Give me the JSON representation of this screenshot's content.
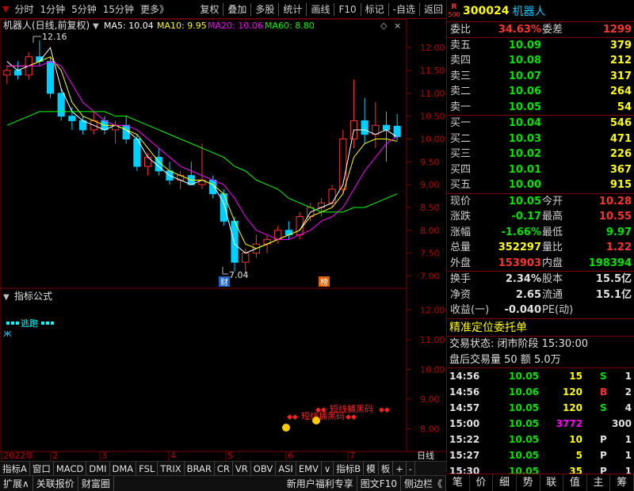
{
  "toolbar": {
    "left": [
      "分时",
      "1分钟",
      "5分钟",
      "15分钟",
      "更多》"
    ],
    "right": [
      "复权",
      "叠加",
      "多股",
      "统计",
      "画线",
      "F10",
      "标记",
      "-自选",
      "返回"
    ]
  },
  "chart": {
    "title": "机器人(日线,前复权)",
    "ma": [
      {
        "label": "MA5: 10.04",
        "color": "#ffffff"
      },
      {
        "label": "MA10: 9.95",
        "color": "#ffff00"
      },
      {
        "label": "MA20: 10.06",
        "color": "#ff00ff"
      },
      {
        "label": "MA60: 8.80",
        "color": "#00ff00"
      }
    ],
    "high_label": "12.16",
    "low_label": "7.04",
    "cai_mark": "财",
    "bang_mark": "榜",
    "indicator_title": "指标公式",
    "escape_label": "逃跑",
    "signal1": "短线捕黑码",
    "signal2": "短线捕黑码",
    "date_labels": [
      "2022年",
      "2",
      "3",
      "4",
      "5",
      "6",
      "7"
    ],
    "rhs_bottom": "日线"
  },
  "chart_data": [
    {
      "type": "line",
      "title": "",
      "ylim": [
        6.8,
        12.35
      ],
      "y_ticks": [
        7.0,
        7.5,
        8.0,
        8.5,
        9.0,
        9.5,
        10.0,
        10.5,
        11.0,
        11.5,
        12.0
      ],
      "x_ticks": [
        "2022年",
        "2",
        "3",
        "4",
        "5",
        "6",
        "7"
      ],
      "series": [
        {
          "name": "MA5",
          "values": [
            11.7,
            11.5,
            11.6,
            11.7,
            12.0,
            11.1,
            10.6,
            10.4,
            10.3,
            10.2,
            10.3,
            10.2,
            10.0,
            9.6,
            9.4,
            9.2,
            9.1,
            9.0,
            9.1,
            9.0,
            8.6,
            7.7,
            7.5,
            7.6,
            7.7,
            7.8,
            7.9,
            8.0,
            8.4,
            8.5,
            8.6,
            9.0,
            10.2,
            10.2,
            10.1,
            10.2,
            10.04
          ]
        },
        {
          "name": "MA10",
          "values": [
            11.6,
            11.6,
            11.6,
            11.7,
            11.8,
            11.5,
            10.8,
            10.5,
            10.4,
            10.3,
            10.3,
            10.2,
            10.1,
            9.8,
            9.5,
            9.3,
            9.2,
            9.1,
            9.1,
            9.0,
            8.8,
            8.2,
            7.7,
            7.6,
            7.7,
            7.8,
            7.9,
            8.0,
            8.3,
            8.4,
            8.5,
            8.8,
            9.6,
            9.9,
            10.0,
            10.0,
            9.95
          ]
        },
        {
          "name": "MA20",
          "values": [
            11.6,
            11.6,
            11.6,
            11.6,
            11.7,
            11.6,
            11.2,
            10.8,
            10.6,
            10.4,
            10.3,
            10.3,
            10.2,
            10.0,
            9.8,
            9.6,
            9.4,
            9.3,
            9.2,
            9.1,
            9.0,
            8.7,
            8.3,
            8.0,
            7.9,
            7.8,
            7.8,
            7.9,
            8.0,
            8.2,
            8.3,
            8.5,
            8.9,
            9.3,
            9.6,
            9.9,
            10.06
          ]
        },
        {
          "name": "MA60",
          "values": [
            10.3,
            10.4,
            10.5,
            10.6,
            10.6,
            10.6,
            10.6,
            10.6,
            10.6,
            10.6,
            10.5,
            10.5,
            10.4,
            10.3,
            10.2,
            10.1,
            10.0,
            9.9,
            9.8,
            9.7,
            9.6,
            9.4,
            9.3,
            9.1,
            9.0,
            8.9,
            8.7,
            8.6,
            8.5,
            8.4,
            8.4,
            8.4,
            8.5,
            8.5,
            8.6,
            8.7,
            8.8
          ]
        }
      ],
      "candles": [
        [
          11.4,
          11.6,
          11.2,
          11.5
        ],
        [
          11.5,
          11.7,
          11.3,
          11.4
        ],
        [
          11.4,
          11.9,
          11.3,
          11.8
        ],
        [
          11.8,
          12.16,
          11.6,
          11.7
        ],
        [
          11.7,
          11.8,
          10.9,
          11.0
        ],
        [
          11.0,
          11.1,
          10.4,
          10.5
        ],
        [
          10.5,
          10.7,
          10.2,
          10.4
        ],
        [
          10.4,
          10.5,
          10.1,
          10.2
        ],
        [
          10.2,
          10.6,
          10.1,
          10.4
        ],
        [
          10.4,
          10.5,
          10.1,
          10.2
        ],
        [
          10.2,
          10.4,
          9.9,
          10.3
        ],
        [
          10.3,
          10.5,
          9.9,
          10.0
        ],
        [
          10.0,
          10.1,
          9.3,
          9.4
        ],
        [
          9.4,
          9.7,
          9.2,
          9.6
        ],
        [
          9.6,
          9.8,
          9.2,
          9.3
        ],
        [
          9.3,
          9.5,
          9.0,
          9.1
        ],
        [
          9.1,
          9.3,
          8.9,
          9.2
        ],
        [
          9.2,
          9.5,
          9.0,
          9.0
        ],
        [
          9.0,
          9.9,
          8.9,
          9.1
        ],
        [
          9.1,
          9.2,
          8.7,
          8.8
        ],
        [
          8.8,
          8.9,
          8.1,
          8.2
        ],
        [
          8.2,
          8.3,
          7.1,
          7.3
        ],
        [
          7.3,
          7.6,
          7.04,
          7.5
        ],
        [
          7.5,
          7.9,
          7.4,
          7.7
        ],
        [
          7.7,
          7.9,
          7.5,
          7.8
        ],
        [
          7.8,
          8.1,
          7.7,
          8.0
        ],
        [
          8.0,
          8.2,
          7.8,
          7.9
        ],
        [
          7.9,
          8.4,
          7.8,
          8.3
        ],
        [
          8.3,
          8.6,
          8.2,
          8.5
        ],
        [
          8.5,
          8.7,
          8.3,
          8.6
        ],
        [
          8.6,
          9.0,
          8.5,
          8.9
        ],
        [
          8.9,
          10.2,
          8.8,
          10.0
        ],
        [
          10.0,
          11.3,
          9.8,
          10.4
        ],
        [
          10.4,
          10.9,
          9.9,
          10.1
        ],
        [
          10.1,
          10.8,
          9.8,
          10.3
        ],
        [
          10.3,
          10.6,
          9.5,
          10.2
        ],
        [
          10.28,
          10.55,
          9.97,
          10.05
        ]
      ]
    },
    {
      "type": "line",
      "title": "",
      "ylim": [
        7.4,
        12.3
      ],
      "y_ticks": [
        8.0,
        9.0,
        10.0,
        11.0,
        12.0
      ]
    }
  ],
  "quote": {
    "code": "300024",
    "name": "机器人",
    "r_label": "R",
    "r_num": "500",
    "weibi_label": "委比",
    "weibi": "34.63%",
    "weicha_label": "委差",
    "weicha": "1299",
    "sell": [
      {
        "label": "卖五",
        "price": "10.09",
        "vol": "379"
      },
      {
        "label": "卖四",
        "price": "10.08",
        "vol": "212"
      },
      {
        "label": "卖三",
        "price": "10.07",
        "vol": "317"
      },
      {
        "label": "卖二",
        "price": "10.06",
        "vol": "264"
      },
      {
        "label": "卖一",
        "price": "10.05",
        "vol": "54"
      }
    ],
    "buy": [
      {
        "label": "买一",
        "price": "10.04",
        "vol": "546"
      },
      {
        "label": "买二",
        "price": "10.03",
        "vol": "471"
      },
      {
        "label": "买三",
        "price": "10.02",
        "vol": "226"
      },
      {
        "label": "买四",
        "price": "10.01",
        "vol": "367"
      },
      {
        "label": "买五",
        "price": "10.00",
        "vol": "915"
      }
    ],
    "stats": [
      {
        "l1": "现价",
        "v1": "10.05",
        "c1": "green",
        "l2": "今开",
        "v2": "10.28",
        "c2": "red"
      },
      {
        "l1": "涨跌",
        "v1": "-0.17",
        "c1": "green",
        "l2": "最高",
        "v2": "10.55",
        "c2": "red"
      },
      {
        "l1": "涨幅",
        "v1": "-1.66%",
        "c1": "green",
        "l2": "最低",
        "v2": "9.97",
        "c2": "green"
      },
      {
        "l1": "总量",
        "v1": "352297",
        "c1": "yellow",
        "l2": "量比",
        "v2": "1.22",
        "c2": "red"
      },
      {
        "l1": "外盘",
        "v1": "153903",
        "c1": "red",
        "l2": "内盘",
        "v2": "198394",
        "c2": "green"
      }
    ],
    "stats2": [
      {
        "l1": "换手",
        "v1": "2.34%",
        "l2": "股本",
        "v2": "15.5亿"
      },
      {
        "l1": "净资",
        "v1": "2.65",
        "l2": "流通",
        "v2": "15.1亿"
      },
      {
        "l1": "收益(一)",
        "v1": "-0.040",
        "l2": "PE(动)",
        "v2": ""
      }
    ],
    "order_title": "精准定位委托单",
    "trade_state": "交易状态: 闭市阶段 15:30:00",
    "after_trade": "盘后交易量 50 额 5.0万",
    "ticks": [
      {
        "time": "14:56",
        "price": "10.05",
        "vol": "15",
        "vc": "yellow",
        "bs": "S",
        "bc": "green",
        "n": "1"
      },
      {
        "time": "14:56",
        "price": "10.06",
        "vol": "120",
        "vc": "yellow",
        "bs": "B",
        "bc": "red",
        "n": "2"
      },
      {
        "time": "14:57",
        "price": "10.05",
        "vol": "120",
        "vc": "yellow",
        "bs": "S",
        "bc": "green",
        "n": "4"
      },
      {
        "time": "15:00",
        "price": "10.05",
        "vol": "3772",
        "vc": "magenta",
        "bs": "",
        "bc": "white",
        "n": "300"
      },
      {
        "time": "15:22",
        "price": "10.05",
        "vol": "10",
        "vc": "yellow",
        "bs": "P",
        "bc": "white",
        "n": "1"
      },
      {
        "time": "15:27",
        "price": "10.05",
        "vol": "5",
        "vc": "yellow",
        "bs": "P",
        "bc": "white",
        "n": "1"
      },
      {
        "time": "15:30",
        "price": "10.05",
        "vol": "35",
        "vc": "yellow",
        "bs": "P",
        "bc": "white",
        "n": "1"
      }
    ]
  },
  "bottom_tabs": [
    "指标A",
    "窗口",
    "MACD",
    "DMI",
    "DMA",
    "FSL",
    "TRIX",
    "BRAR",
    "CR",
    "VR",
    "OBV",
    "ASI",
    "EMV",
    "∨",
    "指标B",
    "模",
    "板",
    "+",
    "-"
  ],
  "bottom_bar": [
    "扩展∧",
    "关联报价",
    "财富圈",
    "新用户福利专享",
    "图文F10",
    "侧边栏《"
  ],
  "side_tabs": [
    "笔",
    "价",
    "细",
    "势",
    "联",
    "值",
    "主",
    "筹"
  ]
}
